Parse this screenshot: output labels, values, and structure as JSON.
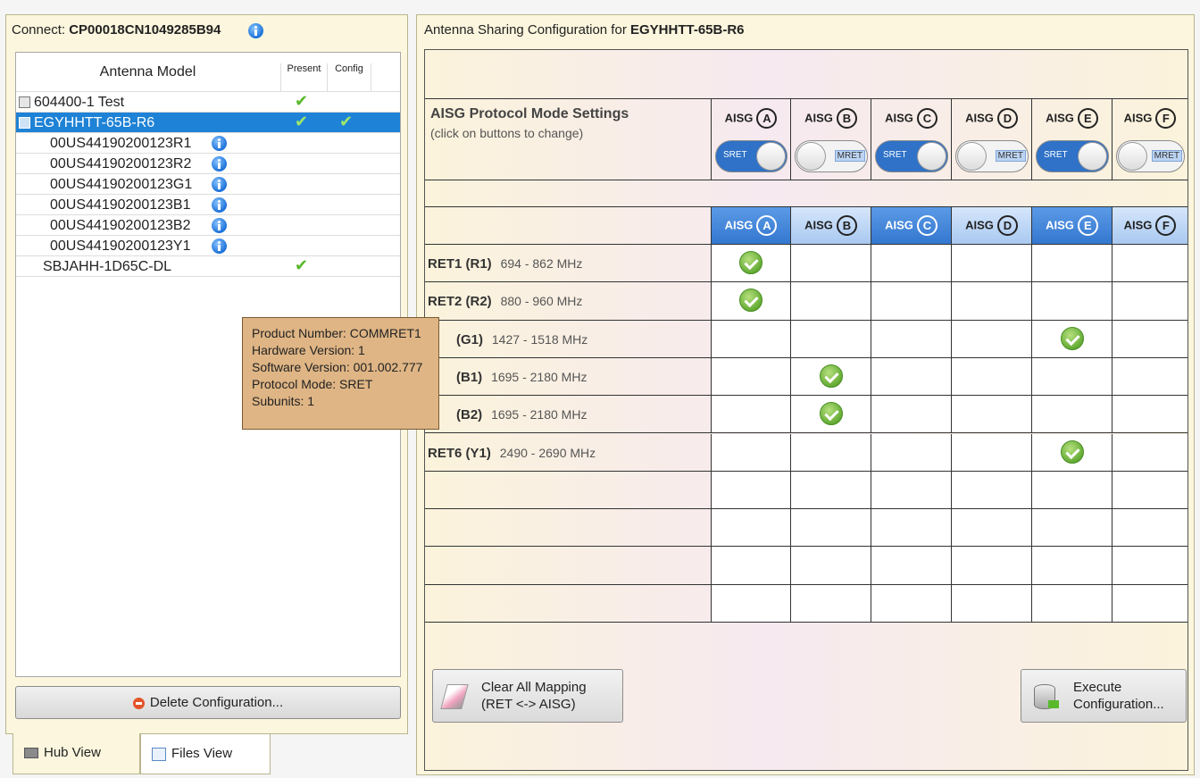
{
  "left": {
    "connect_label": "Connect:",
    "connect_id": "CP00018CN1049285B94",
    "col_model": "Antenna Model",
    "col_present": "Present",
    "col_config": "Config",
    "rows": [
      {
        "label": "604400-1 Test",
        "present": "✔",
        "config": ""
      },
      {
        "label": "EGYHHTT-65B-R6",
        "present": "✔",
        "config": "✔"
      },
      {
        "label": "00US44190200123R1"
      },
      {
        "label": "00US44190200123R2"
      },
      {
        "label": "00US44190200123G1"
      },
      {
        "label": "00US44190200123B1"
      },
      {
        "label": "00US44190200123B2"
      },
      {
        "label": "00US44190200123Y1"
      },
      {
        "label": "SBJAHH-1D65C-DL",
        "present": "✔"
      }
    ],
    "delete_label": "Delete Configuration...",
    "tab_hub": "Hub View",
    "tab_files": "Files View"
  },
  "tooltip": {
    "line1": "Product Number:  COMMRET1",
    "line2": "Hardware Version:  1",
    "line3": "Software Version:  001.002.777",
    "line4": "Protocol Mode: SRET",
    "line5": "Subunits: 1"
  },
  "right": {
    "title_prefix": "Antenna Sharing Configuration for ",
    "title_model": "EGYHHTT-65B-R6",
    "mode_title": "AISG Protocol Mode Settings",
    "mode_hint": "(click on buttons to change)",
    "aisg_word": "AISG",
    "ports": [
      "A",
      "B",
      "C",
      "D",
      "E",
      "F"
    ],
    "modes": [
      "SRET",
      "MRET",
      "SRET",
      "MRET",
      "SRET",
      "MRET"
    ],
    "ret_rows": [
      {
        "name": "RET1 (R1)",
        "freq": "694 -  862 MHz",
        "col": 0
      },
      {
        "name": "RET2 (R2)",
        "freq": "880 -  960 MHz",
        "col": 0
      },
      {
        "name": "(G1)",
        "freq": "1427 - 1518 MHz",
        "col": 4
      },
      {
        "name": "(B1)",
        "freq": "1695 - 2180 MHz",
        "col": 1
      },
      {
        "name": "(B2)",
        "freq": "1695 - 2180 MHz",
        "col": 1
      },
      {
        "name": "RET6 (Y1)",
        "freq": "2490 - 2690 MHz",
        "col": 4
      }
    ],
    "clear_line1": "Clear All Mapping",
    "clear_line2": "(RET <-> AISG)",
    "exec_line1": "Execute",
    "exec_line2": "Configuration..."
  },
  "colors": {
    "selected": "#1e82d6",
    "header_blue": "#3b86de",
    "tooltip_bg": "#e0b787"
  }
}
